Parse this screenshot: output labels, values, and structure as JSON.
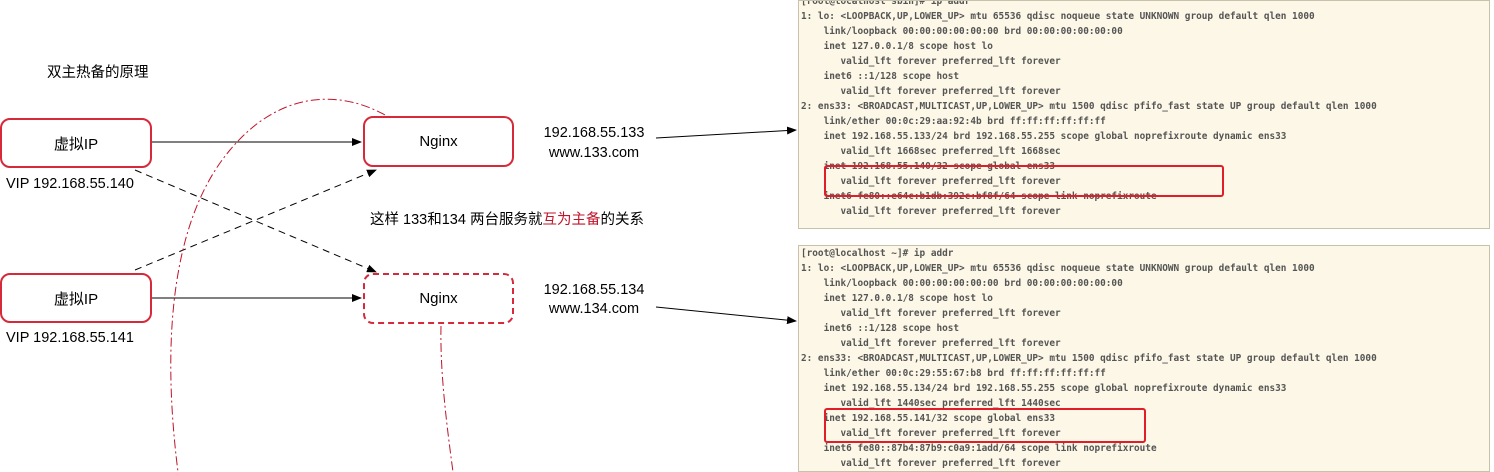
{
  "title": "双主热备的原理",
  "vip_box_1": "虚拟IP",
  "vip_label_1": "VIP 192.168.55.140",
  "vip_box_2": "虚拟IP",
  "vip_label_2": "VIP 192.168.55.141",
  "nginx_1": "Nginx",
  "nginx_2": "Nginx",
  "server_1": {
    "ip": "192.168.55.133",
    "domain": "www.133.com"
  },
  "server_2": {
    "ip": "192.168.55.134",
    "domain": "www.134.com"
  },
  "note": {
    "before": "这样 133和134 两台服务就",
    "highlight": "互为主备",
    "after": "的关系"
  },
  "colors": {
    "accent_red": "#d6293a",
    "terminal_bg": "#fcf7e6",
    "highlight_red": "#e11d2a"
  },
  "terminal_1": [
    "[root@localhost sbin]# ip addr",
    "1: lo: <LOOPBACK,UP,LOWER_UP> mtu 65536 qdisc noqueue state UNKNOWN group default qlen 1000",
    "    link/loopback 00:00:00:00:00:00 brd 00:00:00:00:00:00",
    "    inet 127.0.0.1/8 scope host lo",
    "       valid_lft forever preferred_lft forever",
    "    inet6 ::1/128 scope host",
    "       valid_lft forever preferred_lft forever",
    "2: ens33: <BROADCAST,MULTICAST,UP,LOWER_UP> mtu 1500 qdisc pfifo_fast state UP group default qlen 1000",
    "    link/ether 00:0c:29:aa:92:4b brd ff:ff:ff:ff:ff:ff",
    "    inet 192.168.55.133/24 brd 192.168.55.255 scope global noprefixroute dynamic ens33",
    "       valid_lft 1668sec preferred_lft 1668sec",
    "    inet 192.168.55.140/32 scope global ens33",
    "       valid_lft forever preferred_lft forever",
    "    inet6 fe80::e64c:b1db:392c:bf8f/64 scope link noprefixroute",
    "       valid_lft forever preferred_lft forever"
  ],
  "terminal_2": [
    "[root@localhost ~]# ip addr",
    "1: lo: <LOOPBACK,UP,LOWER_UP> mtu 65536 qdisc noqueue state UNKNOWN group default qlen 1000",
    "    link/loopback 00:00:00:00:00:00 brd 00:00:00:00:00:00",
    "    inet 127.0.0.1/8 scope host lo",
    "       valid_lft forever preferred_lft forever",
    "    inet6 ::1/128 scope host",
    "       valid_lft forever preferred_lft forever",
    "2: ens33: <BROADCAST,MULTICAST,UP,LOWER_UP> mtu 1500 qdisc pfifo_fast state UP group default qlen 1000",
    "    link/ether 00:0c:29:55:67:b8 brd ff:ff:ff:ff:ff:ff",
    "    inet 192.168.55.134/24 brd 192.168.55.255 scope global noprefixroute dynamic ens33",
    "       valid_lft 1440sec preferred_lft 1440sec",
    "    inet 192.168.55.141/32 scope global ens33",
    "       valid_lft forever preferred_lft forever",
    "    inet6 fe80::87b4:87b9:c0a9:1add/64 scope link noprefixroute",
    "       valid_lft forever preferred_lft forever"
  ]
}
